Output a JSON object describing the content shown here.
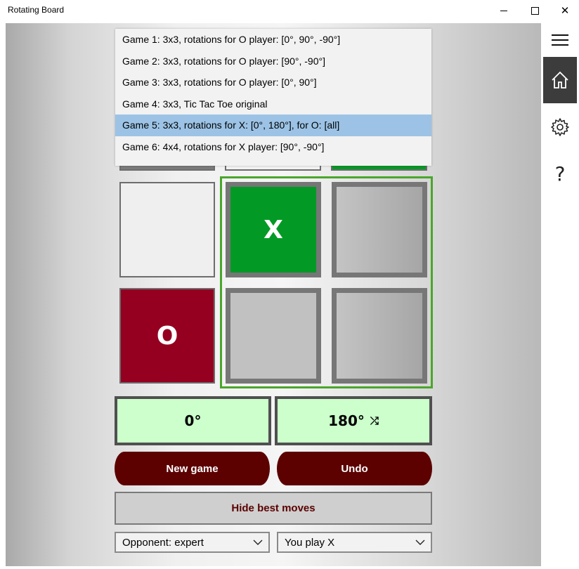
{
  "window": {
    "title": "Rotating Board",
    "minimize_glyph": "",
    "maximize_glyph": "",
    "close_glyph": "✕"
  },
  "sidebar": {
    "items": [
      {
        "name": "menu",
        "icon": "hamburger-icon"
      },
      {
        "name": "home",
        "icon": "home-icon",
        "active": true
      },
      {
        "name": "settings",
        "icon": "gear-icon"
      },
      {
        "name": "help",
        "icon": "question-icon",
        "glyph": "?"
      }
    ]
  },
  "game_menu": {
    "items": [
      "Game 1: 3x3, rotations for O player: [0°, 90°, -90°]",
      "Game 2: 3x3, rotations for O player: [90°, -90°]",
      "Game 3: 3x3, rotations for O player: [0°, 90°]",
      "Game 4: 3x3, Tic Tac Toe original",
      "Game 5: 3x3, rotations for X: [0°, 180°], for O: [all]",
      "Game 6: 4x4, rotations for X player: [90°, -90°]"
    ],
    "selected_index": 4
  },
  "board": {
    "cells": [
      {
        "row": 1,
        "col": 0,
        "mark": "",
        "style": "empty-white"
      },
      {
        "row": 1,
        "col": 1,
        "mark": "X",
        "style": "x-green"
      },
      {
        "row": 1,
        "col": 2,
        "mark": "",
        "style": "gray"
      },
      {
        "row": 2,
        "col": 0,
        "mark": "O",
        "style": "o-red"
      },
      {
        "row": 2,
        "col": 1,
        "mark": "",
        "style": "gray"
      },
      {
        "row": 2,
        "col": 2,
        "mark": "",
        "style": "gray"
      }
    ],
    "colors": {
      "x": "#029a25",
      "o": "#950020",
      "highlight": "#4aa62b"
    }
  },
  "rotations": {
    "left_label": "0°",
    "right_label": "180°",
    "right_icon": "shuffle-icon",
    "right_icon_glyph": "⤮",
    "bg_color": "#ccffcc"
  },
  "actions": {
    "new_game": "New game",
    "undo": "Undo",
    "hide_best_moves": "Hide best moves",
    "button_color": "#5c0000"
  },
  "selects": {
    "opponent": "Opponent: expert",
    "player": "You play X"
  }
}
